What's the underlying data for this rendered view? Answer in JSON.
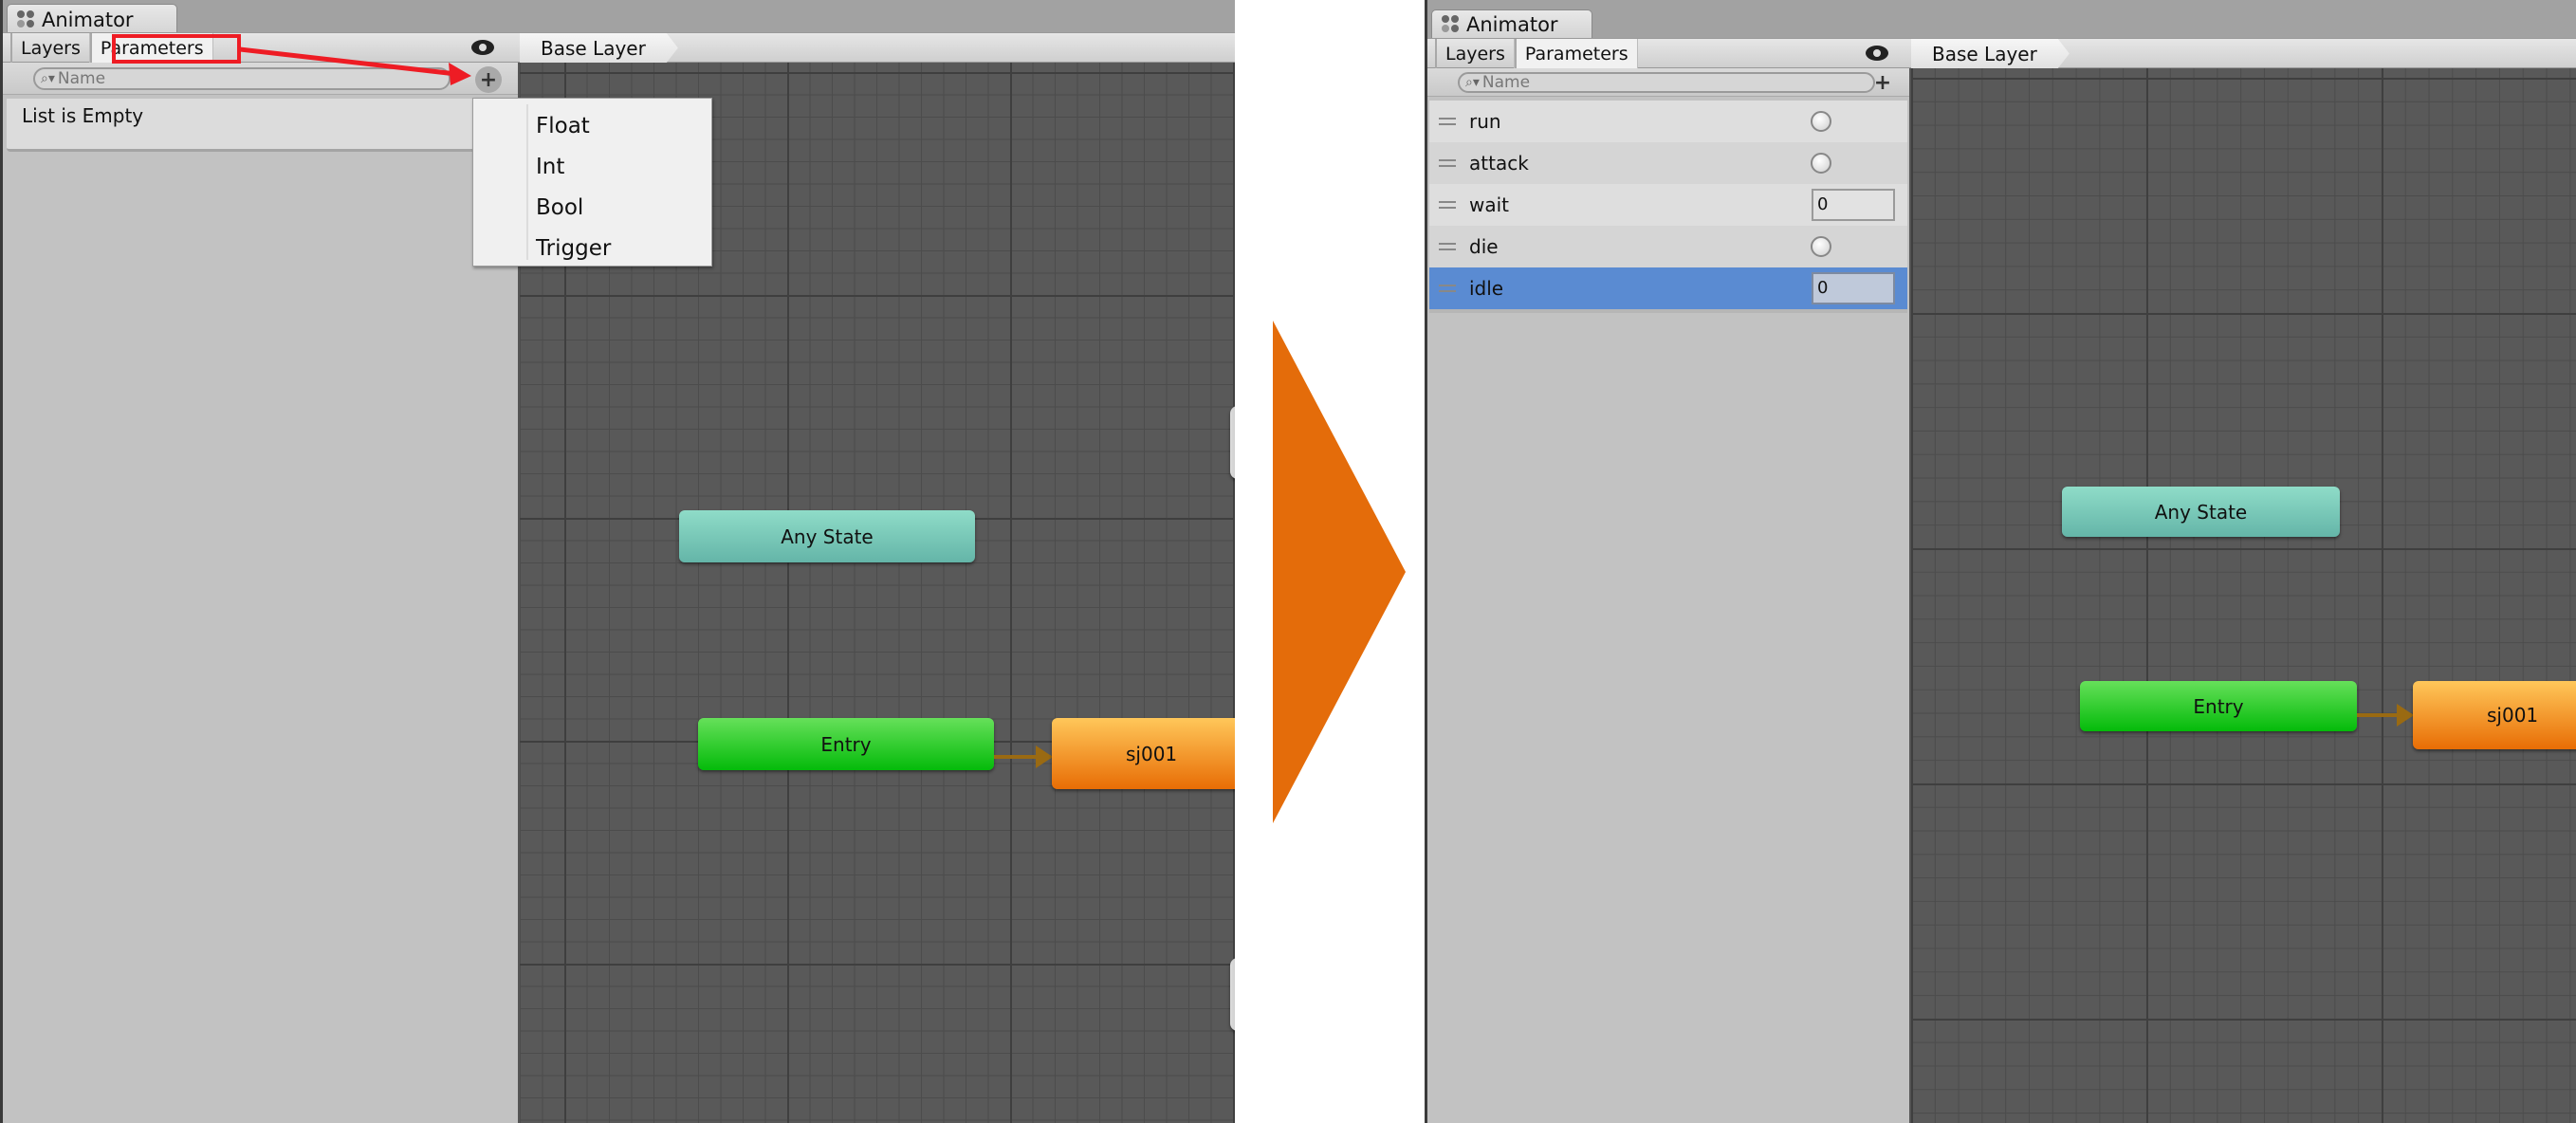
{
  "before": {
    "window_tab": "Animator",
    "side_tabs": [
      "Layers",
      "Parameters"
    ],
    "active_side_tab": "Parameters",
    "breadcrumb": "Base Layer",
    "search": {
      "placeholder": "Name"
    },
    "empty_message": "List is Empty",
    "add_menu": {
      "items": [
        "Float",
        "Int",
        "Bool",
        "Trigger"
      ]
    },
    "nodes": {
      "any_state": "Any State",
      "entry": "Entry",
      "state": "sj001"
    },
    "annotation": {
      "highlight_target": "Parameters",
      "color": "#ee1c24"
    }
  },
  "transition_arrow": {
    "color": "#e46c0a"
  },
  "after": {
    "window_tab": "Animator",
    "side_tabs": [
      "Layers",
      "Parameters"
    ],
    "active_side_tab": "Parameters",
    "breadcrumb": "Base Layer",
    "search": {
      "placeholder": "Name"
    },
    "parameters": [
      {
        "name": "run",
        "type": "bool",
        "value": false
      },
      {
        "name": "attack",
        "type": "bool",
        "value": false
      },
      {
        "name": "wait",
        "type": "int",
        "value": "0"
      },
      {
        "name": "die",
        "type": "bool",
        "value": false
      },
      {
        "name": "idle",
        "type": "int",
        "value": "0",
        "selected": true
      }
    ],
    "nodes": {
      "any_state": "Any State",
      "entry": "Entry",
      "state": "sj001"
    },
    "selection_color": "#5a8bd2"
  },
  "icons": {
    "window": "animator-icon",
    "visibility": "eye-icon",
    "add": "plus-icon",
    "search": "search-icon",
    "drag": "drag-handle-icon"
  }
}
